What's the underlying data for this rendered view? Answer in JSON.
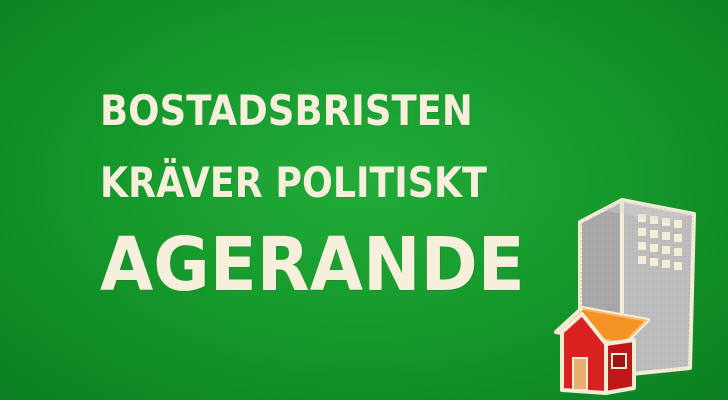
{
  "headline": {
    "line1": "BOSTADSBRISTEN",
    "line2": "KRÄVER POLITISKT",
    "line3": "AGERANDE"
  },
  "colors": {
    "background": "#169a2c",
    "text": "#f5efdc",
    "building": "#a9a9a9",
    "house_wall": "#d9211f",
    "house_roof": "#f08a1a"
  },
  "icons": {
    "building": "apartment-building-icon",
    "house": "red-house-icon"
  }
}
